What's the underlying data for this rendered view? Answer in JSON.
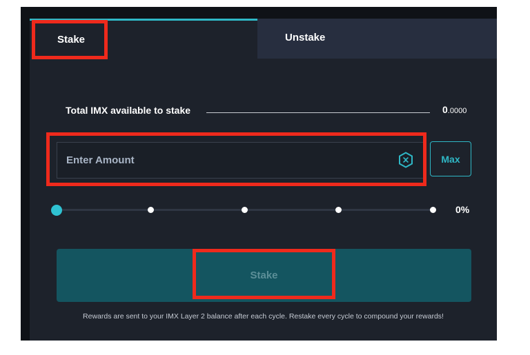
{
  "tabs": [
    {
      "label": "Stake",
      "active": true
    },
    {
      "label": "Unstake",
      "active": false
    }
  ],
  "total": {
    "label": "Total IMX available to stake",
    "value_int": "0",
    "value_dec": ".0000"
  },
  "amount": {
    "placeholder": "Enter Amount",
    "value": "",
    "icon": "imx-token-icon"
  },
  "max_label": "Max",
  "slider": {
    "percent_label": "0%",
    "value": 0,
    "stops": [
      0,
      25,
      50,
      75,
      100
    ]
  },
  "stake_button_label": "Stake",
  "footer_note": "Rewards are sent to your IMX Layer 2 balance after each cycle. Restake every cycle to compound your rewards!",
  "colors": {
    "accent": "#2fb8c6",
    "highlight": "#ef2a1c",
    "background": "#1d222b",
    "button": "#145560"
  }
}
